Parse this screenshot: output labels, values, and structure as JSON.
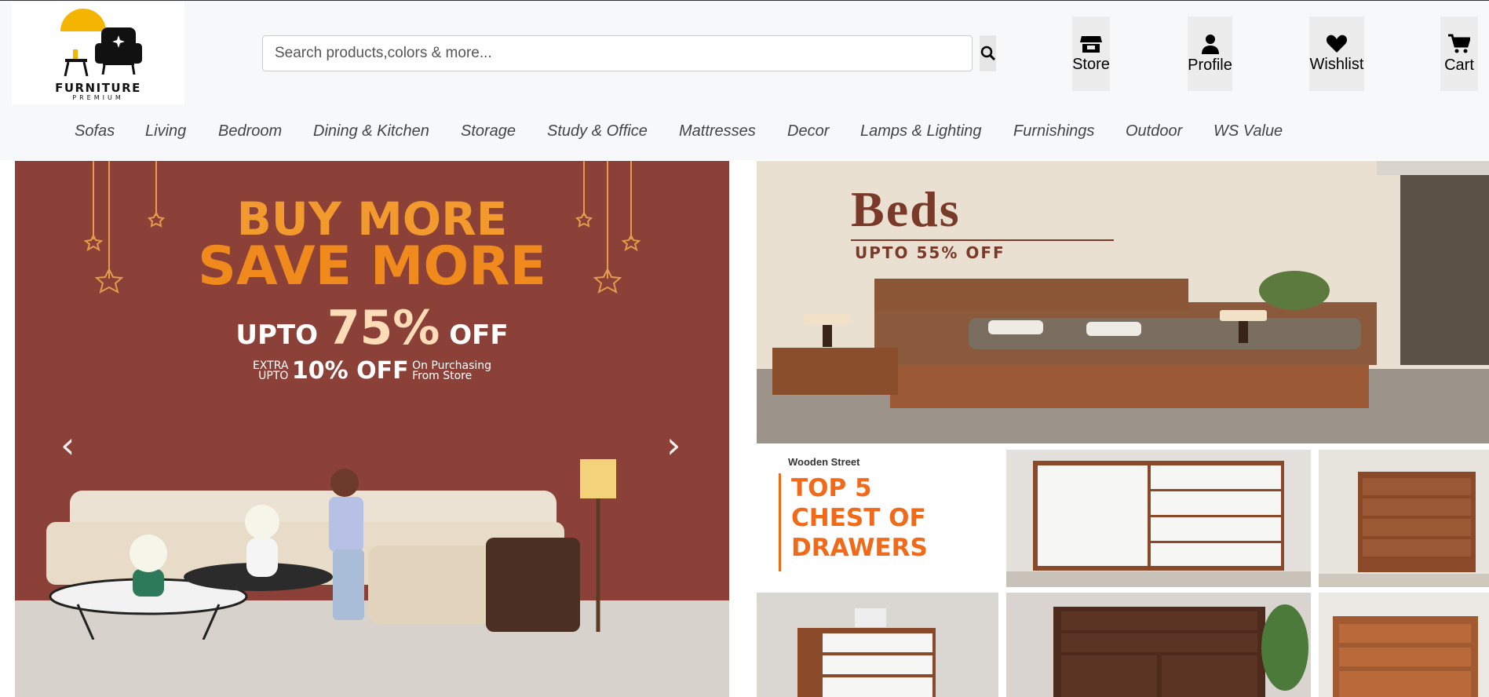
{
  "logo": {
    "brand": "FURNITURE",
    "sub": "PREMIUM"
  },
  "search": {
    "placeholder": "Search products,colors & more..."
  },
  "nav": {
    "store": "Store",
    "profile": "Profile",
    "wishlist": "Wishlist",
    "cart": "Cart"
  },
  "categories": [
    "Sofas",
    "Living",
    "Bedroom",
    "Dining & Kitchen",
    "Storage",
    "Study & Office",
    "Mattresses",
    "Decor",
    "Lamps & Lighting",
    "Furnishings",
    "Outdoor",
    "WS Value"
  ],
  "hero": {
    "line1": "BUY MORE",
    "line2": "SAVE MORE",
    "upto": "UPTO",
    "percent": "75%",
    "off": "OFF",
    "extra_a": "EXTRA",
    "extra_b": "UPTO",
    "extra_pct": "10% OFF",
    "extra_c": "On Purchasing",
    "extra_d": "From Store",
    "prev": "‹",
    "next": "›"
  },
  "beds": {
    "title": "Beds",
    "offer": "UPTO 55% OFF"
  },
  "chest": {
    "brand": "Wooden Street",
    "l1": "TOP 5",
    "l2": "CHEST OF",
    "l3": "DRAWERS"
  }
}
